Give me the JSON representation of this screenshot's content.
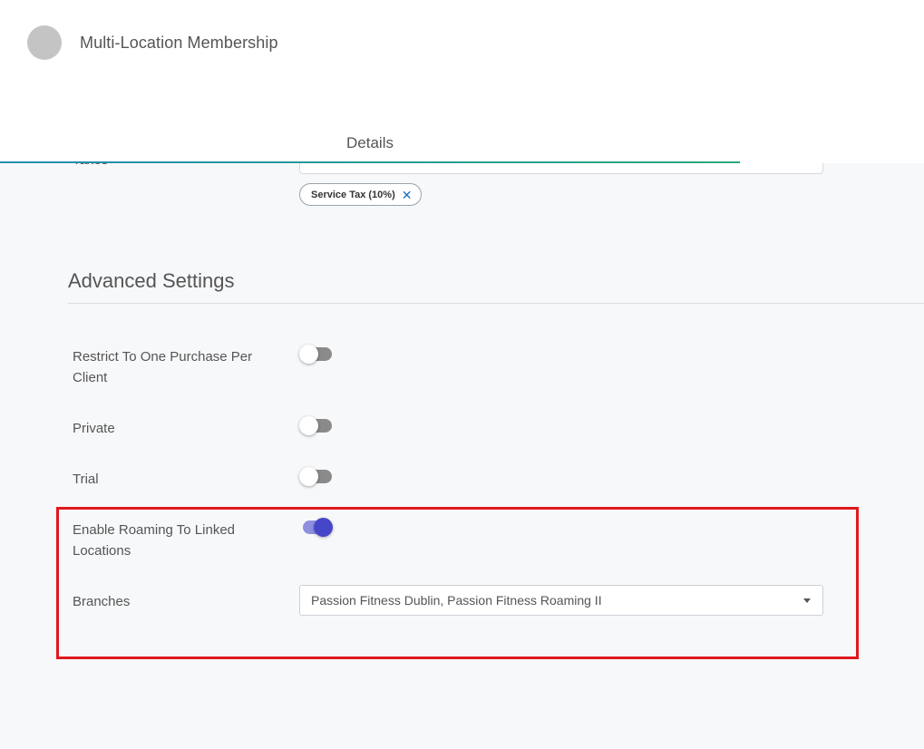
{
  "header": {
    "title": "Multi-Location Membership",
    "tab": "Details"
  },
  "taxes": {
    "label": "Taxes",
    "chip": "Service Tax (10%)",
    "chip_remove": "✕"
  },
  "advanced": {
    "heading": "Advanced Settings",
    "fields": {
      "restrict": {
        "label": "Restrict To One Purchase Per Client",
        "enabled": false
      },
      "private": {
        "label": "Private",
        "enabled": false
      },
      "trial": {
        "label": "Trial",
        "enabled": false
      },
      "roaming": {
        "label": "Enable Roaming To Linked Locations",
        "enabled": true
      }
    },
    "branches": {
      "label": "Branches",
      "value": "Passion Fitness Dublin, Passion Fitness Roaming II"
    }
  },
  "colors": {
    "accent": "#4646c8",
    "highlight": "#e0191d",
    "tab_underline": "#1e8fb0"
  }
}
